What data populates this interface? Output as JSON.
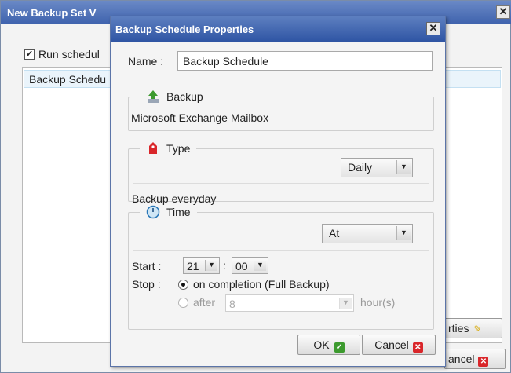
{
  "background_dialog": {
    "title": "New Backup Set V",
    "close_glyph": "✕",
    "run_scheduled_label": "Run schedul",
    "run_scheduled_checked": true,
    "list_row": "Backup Schedu",
    "properties_button": "rties",
    "cancel_button": "ancel"
  },
  "dialog": {
    "title": "Backup Schedule Properties",
    "close_glyph": "✕",
    "name_label": "Name :",
    "name_value": "Backup Schedule",
    "backup_group": {
      "label": "Backup",
      "icon": "backup-up-arrow-icon",
      "value": "Microsoft Exchange Mailbox"
    },
    "type_group": {
      "label": "Type",
      "icon": "red-tag-icon",
      "selected": "Daily",
      "description": "Backup everyday"
    },
    "time_group": {
      "label": "Time",
      "icon": "clock-icon",
      "mode_selected": "At",
      "start_label": "Start :",
      "start_hour": "21",
      "start_separator": ":",
      "start_minute": "00",
      "stop_label": "Stop :",
      "stop_option_completion": "on completion (Full Backup)",
      "stop_option_after": "after",
      "after_value": "8",
      "after_unit": "hour(s)",
      "stop_selected": "on completion (Full Backup)"
    },
    "ok_button": "OK",
    "cancel_button": "Cancel"
  },
  "colors": {
    "titlebar": "#3e62ad",
    "ok_icon": "#3c9a2e",
    "cancel_icon": "#d9262a"
  }
}
